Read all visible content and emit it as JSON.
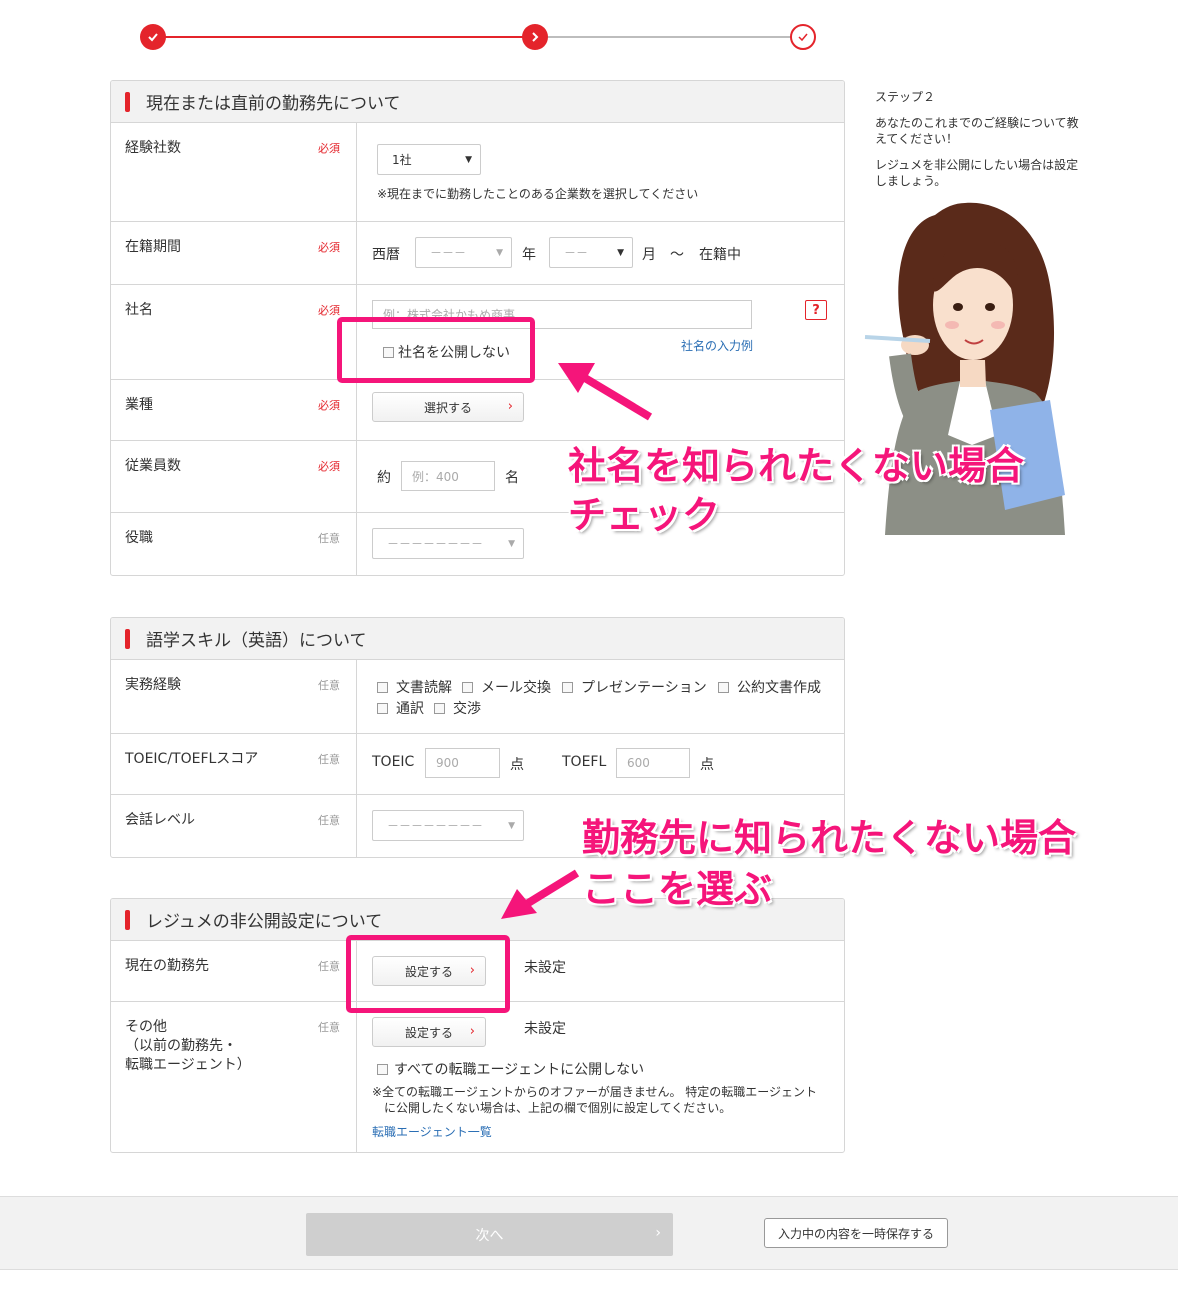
{
  "progress": {
    "steps": [
      {
        "state": "done"
      },
      {
        "state": "current"
      },
      {
        "state": "pending"
      }
    ]
  },
  "work_section": {
    "title": "現在または直前の勤務先について",
    "companies_count": {
      "label": "経験社数",
      "tag": "必須",
      "value": "1社",
      "note": "※現在までに勤務したことのある企業数を選択してください"
    },
    "tenure": {
      "label": "在籍期間",
      "tag": "必須",
      "era_label": "西暦",
      "year_placeholder": "－－－",
      "year_unit": "年",
      "month_placeholder": "－－",
      "month_unit": "月",
      "tilde": "～",
      "status": "在籍中"
    },
    "company_name": {
      "label": "社名",
      "tag": "必須",
      "placeholder": "例：株式会社かもめ商事",
      "hide_label": "社名を公開しない",
      "example_link": "社名の入力例",
      "help": "?"
    },
    "industry": {
      "label": "業種",
      "tag": "必須",
      "button": "選択する"
    },
    "employees": {
      "label": "従業員数",
      "tag": "必須",
      "prefix": "約",
      "placeholder": "例：400",
      "unit": "名"
    },
    "position": {
      "label": "役職",
      "tag": "任意",
      "placeholder": "－－－－－－－－"
    }
  },
  "language_section": {
    "title": "語学スキル（英語）について",
    "experience": {
      "label": "実務経験",
      "tag": "任意",
      "options": [
        "文書読解",
        "メール交換",
        "プレゼンテーション",
        "公約文書作成",
        "通訳",
        "交渉"
      ]
    },
    "scores": {
      "label": "TOEIC/TOEFLスコア",
      "tag": "任意",
      "toeic_label": "TOEIC",
      "toeic_placeholder": "900",
      "toefl_label": "TOEFL",
      "toefl_placeholder": "600",
      "unit": "点"
    },
    "conversation": {
      "label": "会話レベル",
      "tag": "任意",
      "placeholder": "－－－－－－－－"
    }
  },
  "privacy_section": {
    "title": "レジュメの非公開設定について",
    "current": {
      "label": "現在の勤務先",
      "tag": "任意",
      "button": "設定する",
      "status": "未設定"
    },
    "other": {
      "label_line1": "その他",
      "label_line2": "（以前の勤務先・",
      "label_line3": "転職エージェント）",
      "tag": "任意",
      "button": "設定する",
      "status": "未設定",
      "hide_all": "すべての転職エージェントに公開しない",
      "note_line1": "※全ての転職エージェントからのオファーが届きません。 特定の転職エージェント",
      "note_line2": "に公開したくない場合は、上記の欄で個別に設定してください。",
      "link": "転職エージェント一覧"
    }
  },
  "side": {
    "step": "ステップ２",
    "line1": "あなたのこれまでのご経験について教",
    "line2": "えてください！",
    "line3": "レジュメを非公開にしたい場合は設定",
    "line4": "しましょう。"
  },
  "annotations": {
    "a1_line1": "社名を知られたくない場合",
    "a1_line2": "チェック",
    "a2_line1": "勤務先に知られたくない場合",
    "a2_line2": "ここを選ぶ"
  },
  "footer": {
    "next": "次へ",
    "save": "入力中の内容を一時保存する"
  },
  "colors": {
    "accent": "#e4242b",
    "annotation": "#f5157a",
    "link": "#2a6eb4"
  }
}
